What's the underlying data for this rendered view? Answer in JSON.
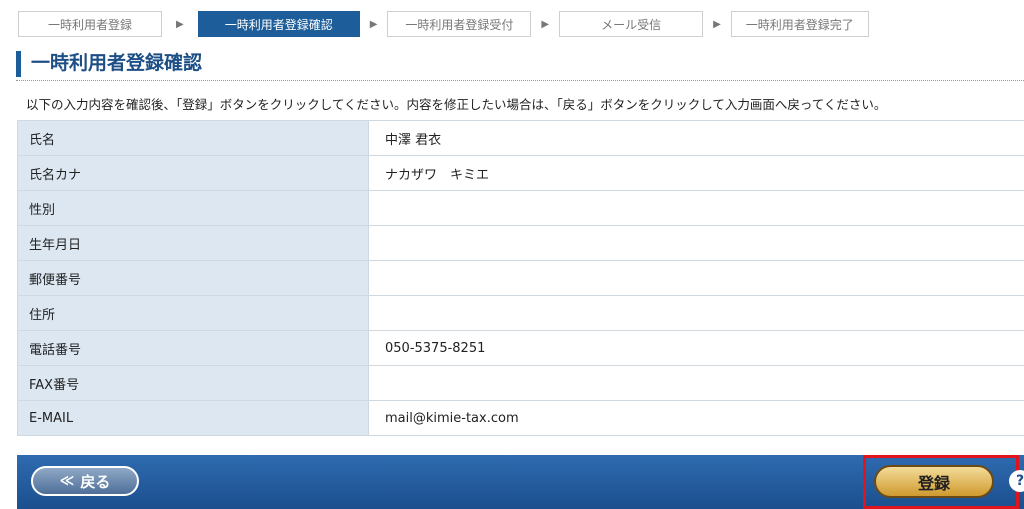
{
  "steps": [
    {
      "label": "一時利用者登録"
    },
    {
      "label": "一時利用者登録確認"
    },
    {
      "label": "一時利用者登録受付"
    },
    {
      "label": "メール受信"
    },
    {
      "label": "一時利用者登録完了"
    }
  ],
  "step_arrow": "▶",
  "active_step": 1,
  "page_title": "一時利用者登録確認",
  "instruction": "以下の入力内容を確認後、「登録」ボタンをクリックしてください。内容を修正したい場合は、「戻る」ボタンをクリックして入力画面へ戻ってください。",
  "fields": [
    {
      "label": "氏名",
      "value": "中澤 君衣"
    },
    {
      "label": "氏名カナ",
      "value": "ナカザワ　キミエ"
    },
    {
      "label": "性別",
      "value": ""
    },
    {
      "label": "生年月日",
      "value": ""
    },
    {
      "label": "郵便番号",
      "value": ""
    },
    {
      "label": "住所",
      "value": ""
    },
    {
      "label": "電話番号",
      "value": "050-5375-8251"
    },
    {
      "label": "FAX番号",
      "value": ""
    },
    {
      "label": "E-MAIL",
      "value": "mail@kimie-tax.com"
    }
  ],
  "footer": {
    "back_chevron": "≪",
    "back_label": "戻る",
    "register_label": "登録",
    "help_glyph": "?"
  },
  "colors": {
    "accent": "#1d5d99",
    "label_bg": "#dce7f2",
    "highlight": "#e0141c",
    "register_gold": "#cf9a2e"
  }
}
